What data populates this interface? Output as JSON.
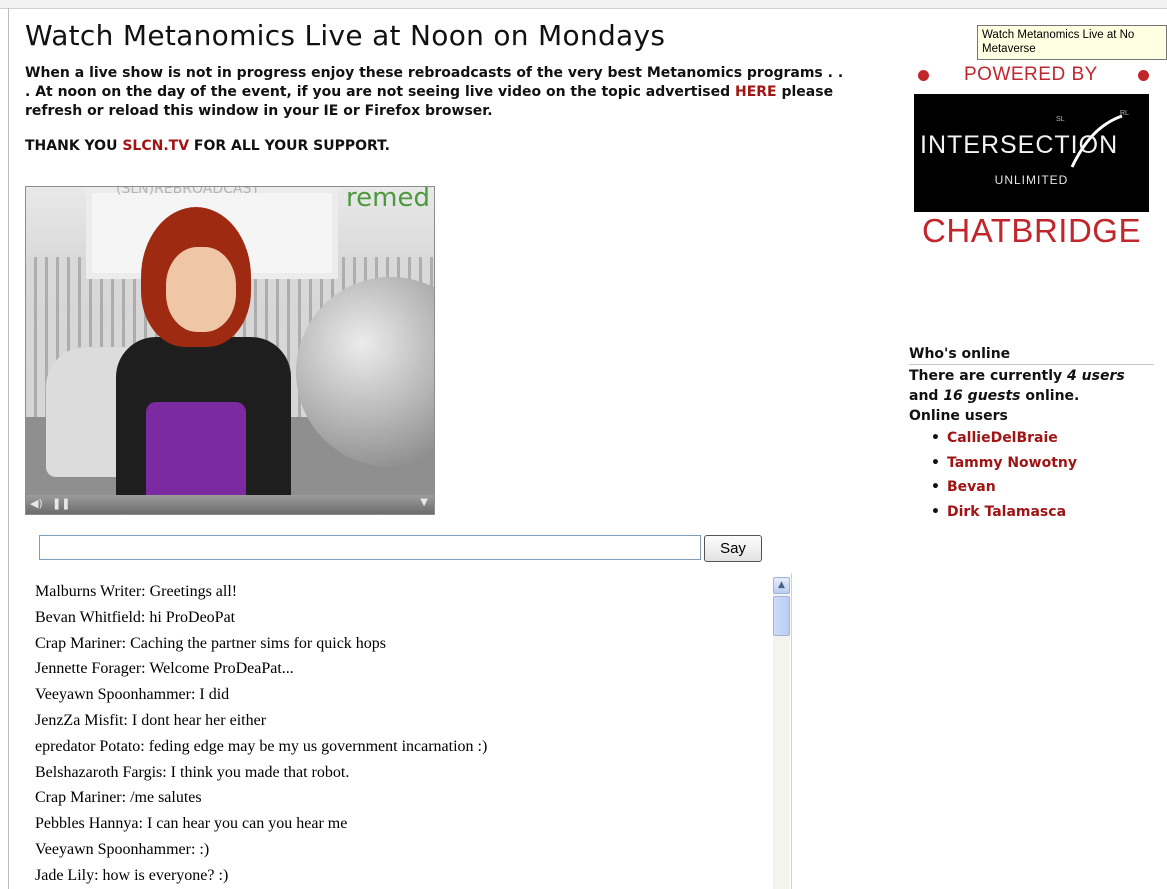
{
  "page": {
    "title": "Watch Metanomics Live at Noon on Mondays",
    "intro_1": "When a live show is not in progress enjoy these rebroadcasts of the very best Metanomics programs . . . At noon on the day of the event, if you are not seeing live video on the topic advertised ",
    "intro_link": "HERE",
    "intro_2": " please refresh or reload this window in your IE or Firefox browser.",
    "thanks_1": "THANK YOU ",
    "thanks_link": "SLCN.TV",
    "thanks_2": " FOR ALL YOUR SUPPORT."
  },
  "video": {
    "overlay_text": "(SLN)REBROADCAST",
    "overlay_green": "remed",
    "volume_icon": "speaker-icon",
    "pause_icon": "pause-icon",
    "menu_icon": "triangle-down-icon"
  },
  "chat": {
    "input_value": "",
    "say_label": "Say",
    "lines": [
      "Malburns Writer: Greetings all!",
      "Bevan Whitfield: hi ProDeoPat",
      "Crap Mariner: Caching the partner sims for quick hops",
      "Jennette Forager: Welcome ProDeaPat...",
      "Veeyawn Spoonhammer: I did",
      "JenzZa Misfit: I dont hear her either",
      "epredator Potato: feding edge may be my us government incarnation :)",
      "Belshazaroth Fargis: I think you made that robot.",
      "Crap Mariner: /me salutes",
      "Pebbles Hannya: I can hear you can you hear me",
      "Veeyawn Spoonhammer: :)",
      "Jade Lily: how is everyone? :)"
    ]
  },
  "tooltip": {
    "text_1": "Watch Metanomics Live at No",
    "text_2": "Metaverse"
  },
  "sidebar": {
    "powered_by": "POWERED BY",
    "logo_sl": "SL",
    "logo_rl": "RL",
    "logo_main": "INTERSECTION",
    "logo_sub": "UNLIMITED",
    "chatbridge": "CHATBRIDGE",
    "whos_online_heading": "Who's online",
    "online_1": "There are currently ",
    "online_users_count": "4 users",
    "online_2": " and ",
    "online_guests_count": "16 guests",
    "online_3": " online.",
    "online_users_label": "Online users",
    "users": [
      "CallieDelBraie",
      "Tammy Nowotny",
      "Bevan",
      "Dirk Talamasca"
    ]
  },
  "colors": {
    "link_red": "#a01414",
    "brand_red": "#c0272d"
  }
}
